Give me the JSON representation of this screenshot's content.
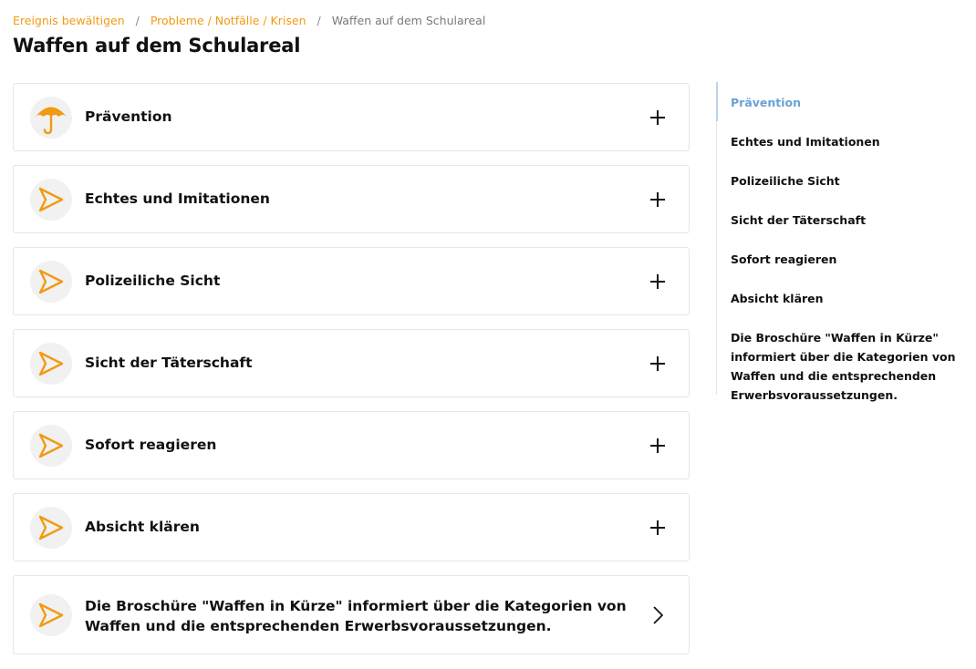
{
  "breadcrumb": {
    "items": [
      "Ereignis bewältigen",
      "Probleme / Notfälle / Krisen"
    ],
    "separator": "/",
    "current": "Waffen auf dem Schulareal"
  },
  "page": {
    "title": "Waffen auf dem Schulareal"
  },
  "accordion": {
    "items": [
      {
        "label": "Prävention",
        "icon": "umbrella-icon",
        "action": "expand"
      },
      {
        "label": "Echtes und Imitationen",
        "icon": "paper-plane-icon",
        "action": "expand"
      },
      {
        "label": "Polizeiliche Sicht",
        "icon": "paper-plane-icon",
        "action": "expand"
      },
      {
        "label": "Sicht der Täterschaft",
        "icon": "paper-plane-icon",
        "action": "expand"
      },
      {
        "label": "Sofort reagieren",
        "icon": "paper-plane-icon",
        "action": "expand"
      },
      {
        "label": "Absicht klären",
        "icon": "paper-plane-icon",
        "action": "expand"
      },
      {
        "label": "Die Broschüre \"Waffen in Kürze\" informiert über die Kategorien von Waffen und die entsprechenden Erwerbsvoraussetzungen.",
        "icon": "paper-plane-icon",
        "action": "link"
      }
    ]
  },
  "toc": {
    "items": [
      "Prävention",
      "Echtes und Imitationen",
      "Polizeiliche Sicht",
      "Sicht der Täterschaft",
      "Sofort reagieren",
      "Absicht klären",
      "Die Broschüre \"Waffen in Kürze\" informiert über die Kategorien von Waffen und die entsprechenden Erwerbsvoraussetzungen."
    ],
    "active_index": 0
  },
  "colors": {
    "accent_orange": "#f29a12",
    "active_blue": "#6aa2d6",
    "icon_bg": "#f1f1f1",
    "border": "#e6e6e6"
  }
}
